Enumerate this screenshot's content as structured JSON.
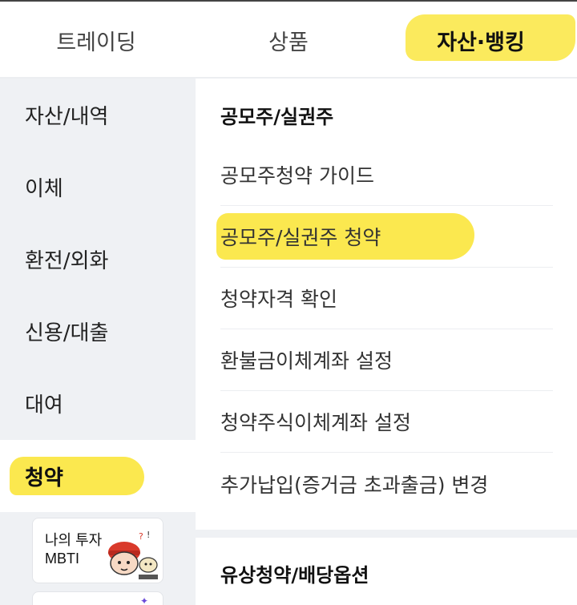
{
  "tabs": [
    {
      "label": "트레이딩"
    },
    {
      "label": "상품"
    },
    {
      "label": "자산·뱅킹",
      "active": true
    }
  ],
  "sidebar": {
    "items": [
      {
        "label": "자산/내역"
      },
      {
        "label": "이체"
      },
      {
        "label": "환전/외화"
      },
      {
        "label": "신용/대출"
      },
      {
        "label": "대여"
      },
      {
        "label": "청약",
        "active": true
      }
    ],
    "banner": {
      "line1": "나의 투자",
      "line2": "MBTI"
    }
  },
  "main": {
    "sections": [
      {
        "title": "공모주/실권주",
        "items": [
          {
            "label": "공모주청약 가이드"
          },
          {
            "label": "공모주/실권주 청약",
            "highlighted": true
          },
          {
            "label": "청약자격 확인"
          },
          {
            "label": "환불금이체계좌 설정"
          },
          {
            "label": "청약주식이체계좌 설정"
          },
          {
            "label": "추가납입(증거금 초과출금) 변경"
          }
        ]
      },
      {
        "title": "유상청약/배당옵션"
      }
    ]
  },
  "colors": {
    "highlight": "#fbe84f",
    "sidebar_bg": "#eff1f4"
  }
}
